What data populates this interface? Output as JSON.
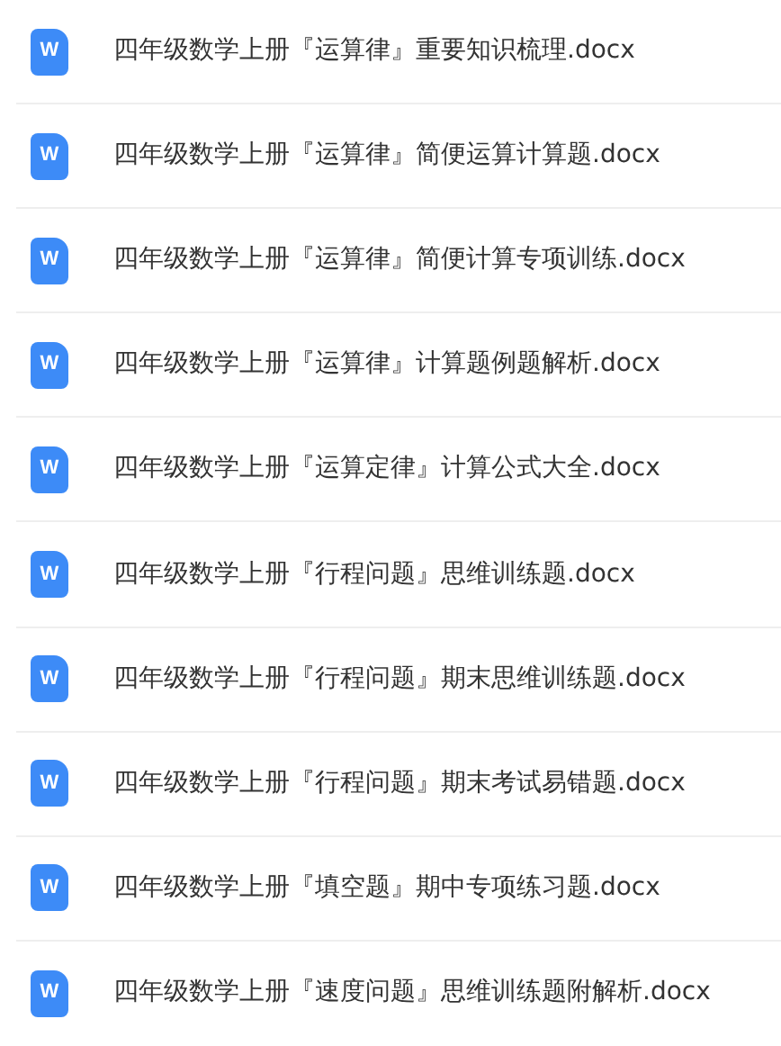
{
  "files": [
    {
      "icon_label": "W",
      "name": "四年级数学上册『运算律』重要知识梳理.docx"
    },
    {
      "icon_label": "W",
      "name": "四年级数学上册『运算律』简便运算计算题.docx"
    },
    {
      "icon_label": "W",
      "name": "四年级数学上册『运算律』简便计算专项训练.docx"
    },
    {
      "icon_label": "W",
      "name": "四年级数学上册『运算律』计算题例题解析.docx"
    },
    {
      "icon_label": "W",
      "name": "四年级数学上册『运算定律』计算公式大全.docx"
    },
    {
      "icon_label": "W",
      "name": "四年级数学上册『行程问题』思维训练题.docx"
    },
    {
      "icon_label": "W",
      "name": "四年级数学上册『行程问题』期末思维训练题.docx"
    },
    {
      "icon_label": "W",
      "name": "四年级数学上册『行程问题』期末考试易错题.docx"
    },
    {
      "icon_label": "W",
      "name": "四年级数学上册『填空题』期中专项练习题.docx"
    },
    {
      "icon_label": "W",
      "name": "四年级数学上册『速度问题』思维训练题附解析.docx"
    }
  ]
}
